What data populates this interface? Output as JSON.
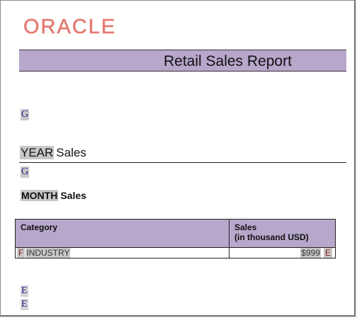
{
  "logo": {
    "text": "ORACLE",
    "color": "#e57b74"
  },
  "report": {
    "title": "Retail Sales Report",
    "band_color": "#b7a7cb"
  },
  "fields": {
    "g_top": "G",
    "g_year": "G",
    "e_bottom_1": "E",
    "e_bottom_2": "E"
  },
  "year_section": {
    "token": "YEAR",
    "label": "Sales"
  },
  "month_section": {
    "token": "MONTH",
    "label": "Sales"
  },
  "table": {
    "header": {
      "category": "Category",
      "sales_line1": "Sales",
      "sales_line2": "(in thousand  USD)"
    },
    "rows": [
      {
        "start_token": "F",
        "category": "INDUSTRY",
        "amount": "$999",
        "end_token": "E"
      }
    ]
  }
}
